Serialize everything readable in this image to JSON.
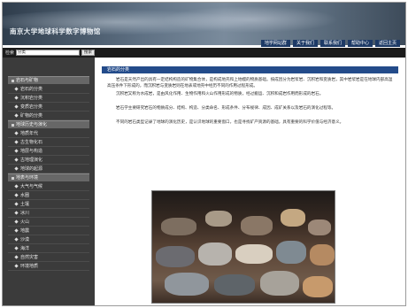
{
  "header": {
    "site_title": "南京大学地球科学数字博物馆",
    "nav": [
      "地学网站群",
      "关于我们",
      "联系我们",
      "帮助中心",
      "返回主页"
    ]
  },
  "search": {
    "label": "检索",
    "value": "分类",
    "button": "搜索"
  },
  "sidebar": {
    "sections": [
      {
        "title": "岩石与矿物",
        "items": [
          "岩石的分类",
          "沉积岩分类",
          "变质岩分类",
          "矿物的分类"
        ]
      },
      {
        "title": "地球历史与演化",
        "items": [
          "地质年代",
          "古生物化石",
          "地层与构造",
          "古地理演化",
          "地球的起源"
        ]
      },
      {
        "title": "地表与环境",
        "items": [
          "大气与气候",
          "水圈",
          "土壤",
          "冰川",
          "火山",
          "地震",
          "沙漠",
          "海洋",
          "自然灾害",
          "环境地质"
        ]
      }
    ]
  },
  "main": {
    "panel_title": "岩石的分类",
    "paragraphs": [
      "岩石是天然产出的具有一定结构构造的矿物集合体，是构成地壳和上地幔的物质基础。按成因分为岩浆岩、沉积岩和变质岩，其中岩浆岩是在地球内部高温高压条件下形成的，而沉积岩与变质岩则在地表或地壳中经历不同的作用过程形成。",
      "沉积岩又称为水成岩，是由风化作用、生物作用和火山作用形成的物质，经过搬运、沉积和成岩作用而形成的岩石。",
      "岩石学主要研究岩石的物质成分、结构、构造、分类命名、形成条件、分布规律、成因、成矿关系以及岩石的演化过程等。",
      "不同的岩石类型记录了地球的演化历史，是认识地球的重要窗口，也是寻找矿产资源的基础，具有重要的科学价值与经济意义。"
    ]
  },
  "colors": {
    "nav_bg": "#1d3a66",
    "panel_head": "#234b8a",
    "sidebar_bg": "#3b3b3b"
  }
}
